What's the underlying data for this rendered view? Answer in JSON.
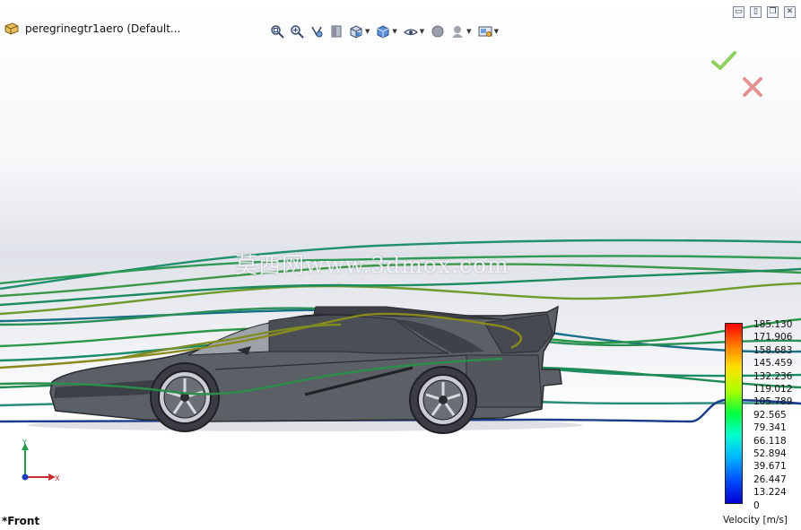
{
  "document": {
    "title": "peregrinegtr1aero  (Default..."
  },
  "toolbar": {
    "icons": [
      "zoom-to-fit-icon",
      "zoom-to-area-icon",
      "previous-view-icon",
      "section-view-icon",
      "view-orientation-icon",
      "display-style-icon",
      "hide-show-items-icon",
      "edit-appearance-icon",
      "apply-scene-icon",
      "view-settings-icon"
    ]
  },
  "confirm": {
    "ok_color": "#7ac943",
    "cancel_color": "#e08080"
  },
  "watermark": {
    "text": "莫西网www.3dmox.com"
  },
  "legend": {
    "title": "Velocity [m/s]",
    "ticks": [
      "185.130",
      "171.906",
      "158.683",
      "145.459",
      "132.236",
      "119.012",
      "105.789",
      "92.565",
      "79.341",
      "66.118",
      "52.894",
      "39.671",
      "26.447",
      "13.224",
      "0"
    ]
  },
  "triad": {
    "y_label": "Y",
    "x_label": "X"
  },
  "view": {
    "name": "*Front"
  }
}
